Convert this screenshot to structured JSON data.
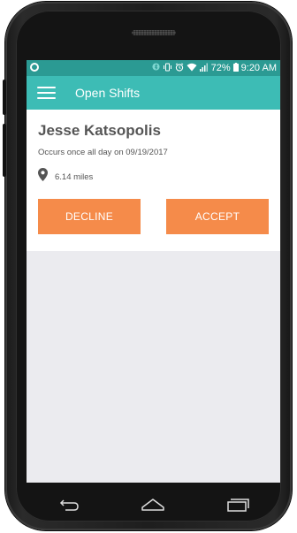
{
  "status_bar": {
    "battery": "72%",
    "time": "9:20 AM",
    "icons": [
      "notification-icon",
      "bluetooth-icon",
      "vibrate-icon",
      "alarm-icon",
      "wifi-icon",
      "signal-icon",
      "battery-icon"
    ]
  },
  "app_bar": {
    "title": "Open Shifts",
    "menu_icon": "hamburger-menu-icon"
  },
  "shift": {
    "name": "Jesse Katsopolis",
    "occurs": "Occurs once all day on 09/19/2017",
    "distance": "6.14 miles",
    "decline_label": "DECLINE",
    "accept_label": "ACCEPT"
  },
  "colors": {
    "status_bar": "#2b9a93",
    "app_bar": "#3dbcb5",
    "button": "#f58b4a",
    "background": "#ebebef"
  },
  "nav_bar": {
    "buttons": [
      "back-icon",
      "home-icon",
      "recents-icon"
    ]
  }
}
